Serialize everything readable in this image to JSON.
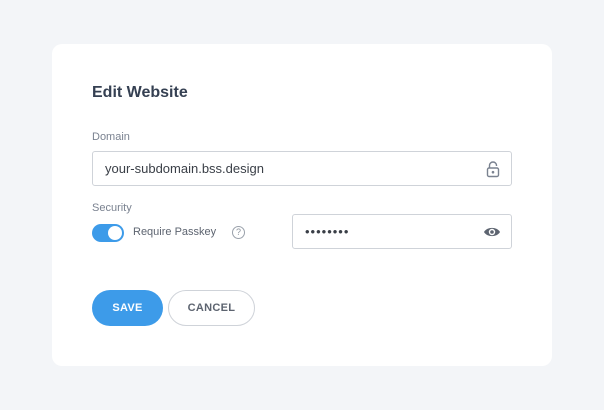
{
  "form": {
    "title": "Edit Website",
    "domain": {
      "label": "Domain",
      "value": "your-subdomain.bss.design",
      "icon": "lock-icon"
    },
    "security": {
      "label": "Security",
      "toggle_on": true,
      "toggle_label": "Require Passkey",
      "help_glyph": "?",
      "password_value": "••••••••",
      "password_icon": "eye-icon"
    },
    "buttons": {
      "save_label": "SAVE",
      "cancel_label": "CANCEL"
    }
  },
  "colors": {
    "background": "#f3f5f8",
    "card": "#ffffff",
    "accent": "#3d9be9",
    "title": "#354052",
    "label": "#7a8290"
  }
}
